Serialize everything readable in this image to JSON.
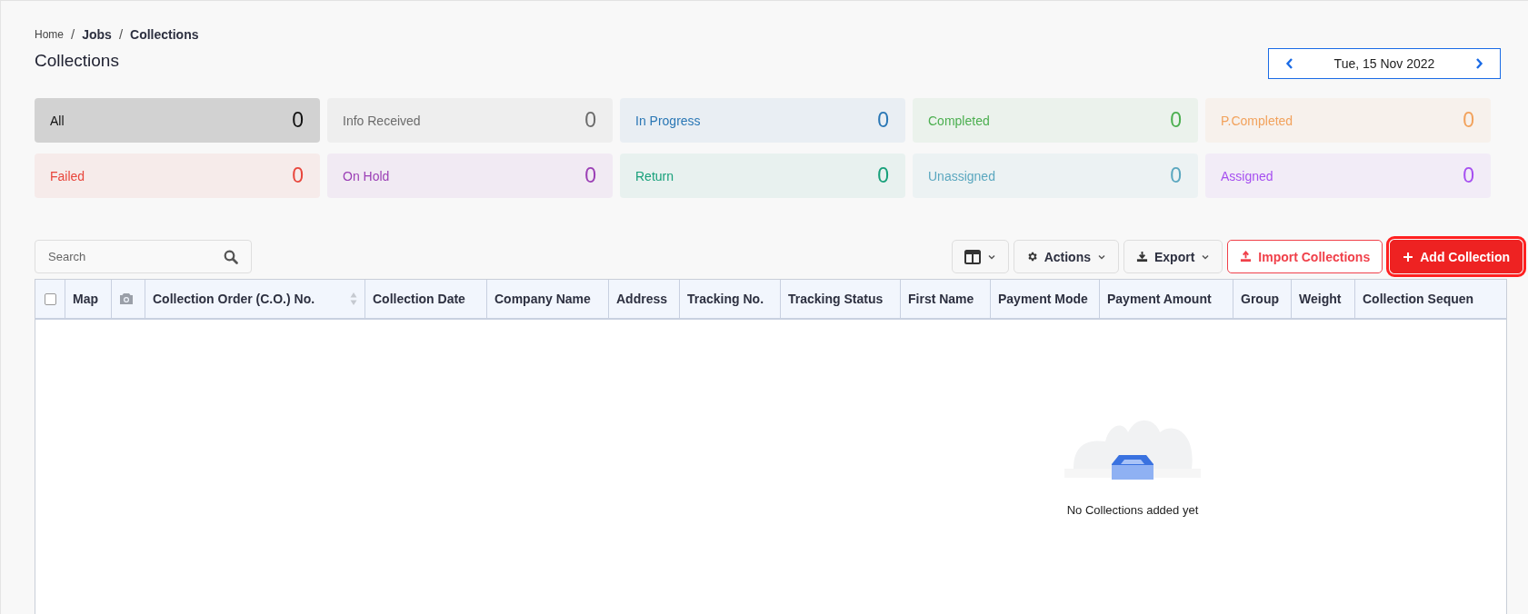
{
  "breadcrumb": [
    {
      "label": "Home",
      "current": false
    },
    {
      "label": "Jobs",
      "current": true
    },
    {
      "label": "Collections",
      "current": true
    }
  ],
  "breadcrumb_separator": "/",
  "title": "Collections",
  "date_picker": {
    "value": "Tue, 15 Nov 2022"
  },
  "status_cards": [
    {
      "label": "All",
      "count": "0",
      "color": "#111111",
      "selected": true
    },
    {
      "label": "Info Received",
      "count": "0",
      "color": "#6b6b6b",
      "selected": false
    },
    {
      "label": "In Progress",
      "count": "0",
      "color": "#2a77b5",
      "selected": false
    },
    {
      "label": "Completed",
      "count": "0",
      "color": "#4caf50",
      "selected": false
    },
    {
      "label": "P.Completed",
      "count": "0",
      "color": "#f2a25c",
      "selected": false
    },
    {
      "label": "Failed",
      "count": "0",
      "color": "#e8463c",
      "selected": false
    },
    {
      "label": "On Hold",
      "count": "0",
      "color": "#9b3fb5",
      "selected": false
    },
    {
      "label": "Return",
      "count": "0",
      "color": "#17a07a",
      "selected": false
    },
    {
      "label": "Unassigned",
      "count": "0",
      "color": "#5aa7bf",
      "selected": false
    },
    {
      "label": "Assigned",
      "count": "0",
      "color": "#a64ff0",
      "selected": false
    }
  ],
  "search": {
    "placeholder": "Search"
  },
  "toolbar": [
    {
      "kind": "columns"
    },
    {
      "kind": "actions",
      "label": "Actions"
    },
    {
      "kind": "export",
      "label": "Export"
    },
    {
      "kind": "import",
      "label": "Import Collections"
    },
    {
      "kind": "add",
      "label": "Add Collection"
    }
  ],
  "table": {
    "select_all_checked": false,
    "columns": [
      {
        "kind": "text",
        "label": "Map"
      },
      {
        "kind": "camera"
      },
      {
        "kind": "sortable",
        "label": "Collection Order (C.O.) No."
      },
      {
        "kind": "text",
        "label": "Collection Date"
      },
      {
        "kind": "text",
        "label": "Company Name"
      },
      {
        "kind": "text",
        "label": "Address"
      },
      {
        "kind": "text",
        "label": "Tracking No."
      },
      {
        "kind": "text",
        "label": "Tracking Status"
      },
      {
        "kind": "text",
        "label": "First Name"
      },
      {
        "kind": "text",
        "label": "Payment Mode"
      },
      {
        "kind": "text",
        "label": "Payment Amount"
      },
      {
        "kind": "text",
        "label": "Group"
      },
      {
        "kind": "text",
        "label": "Weight"
      },
      {
        "kind": "text",
        "label": "Collection Sequen"
      }
    ],
    "empty_message": "No Collections added yet"
  }
}
